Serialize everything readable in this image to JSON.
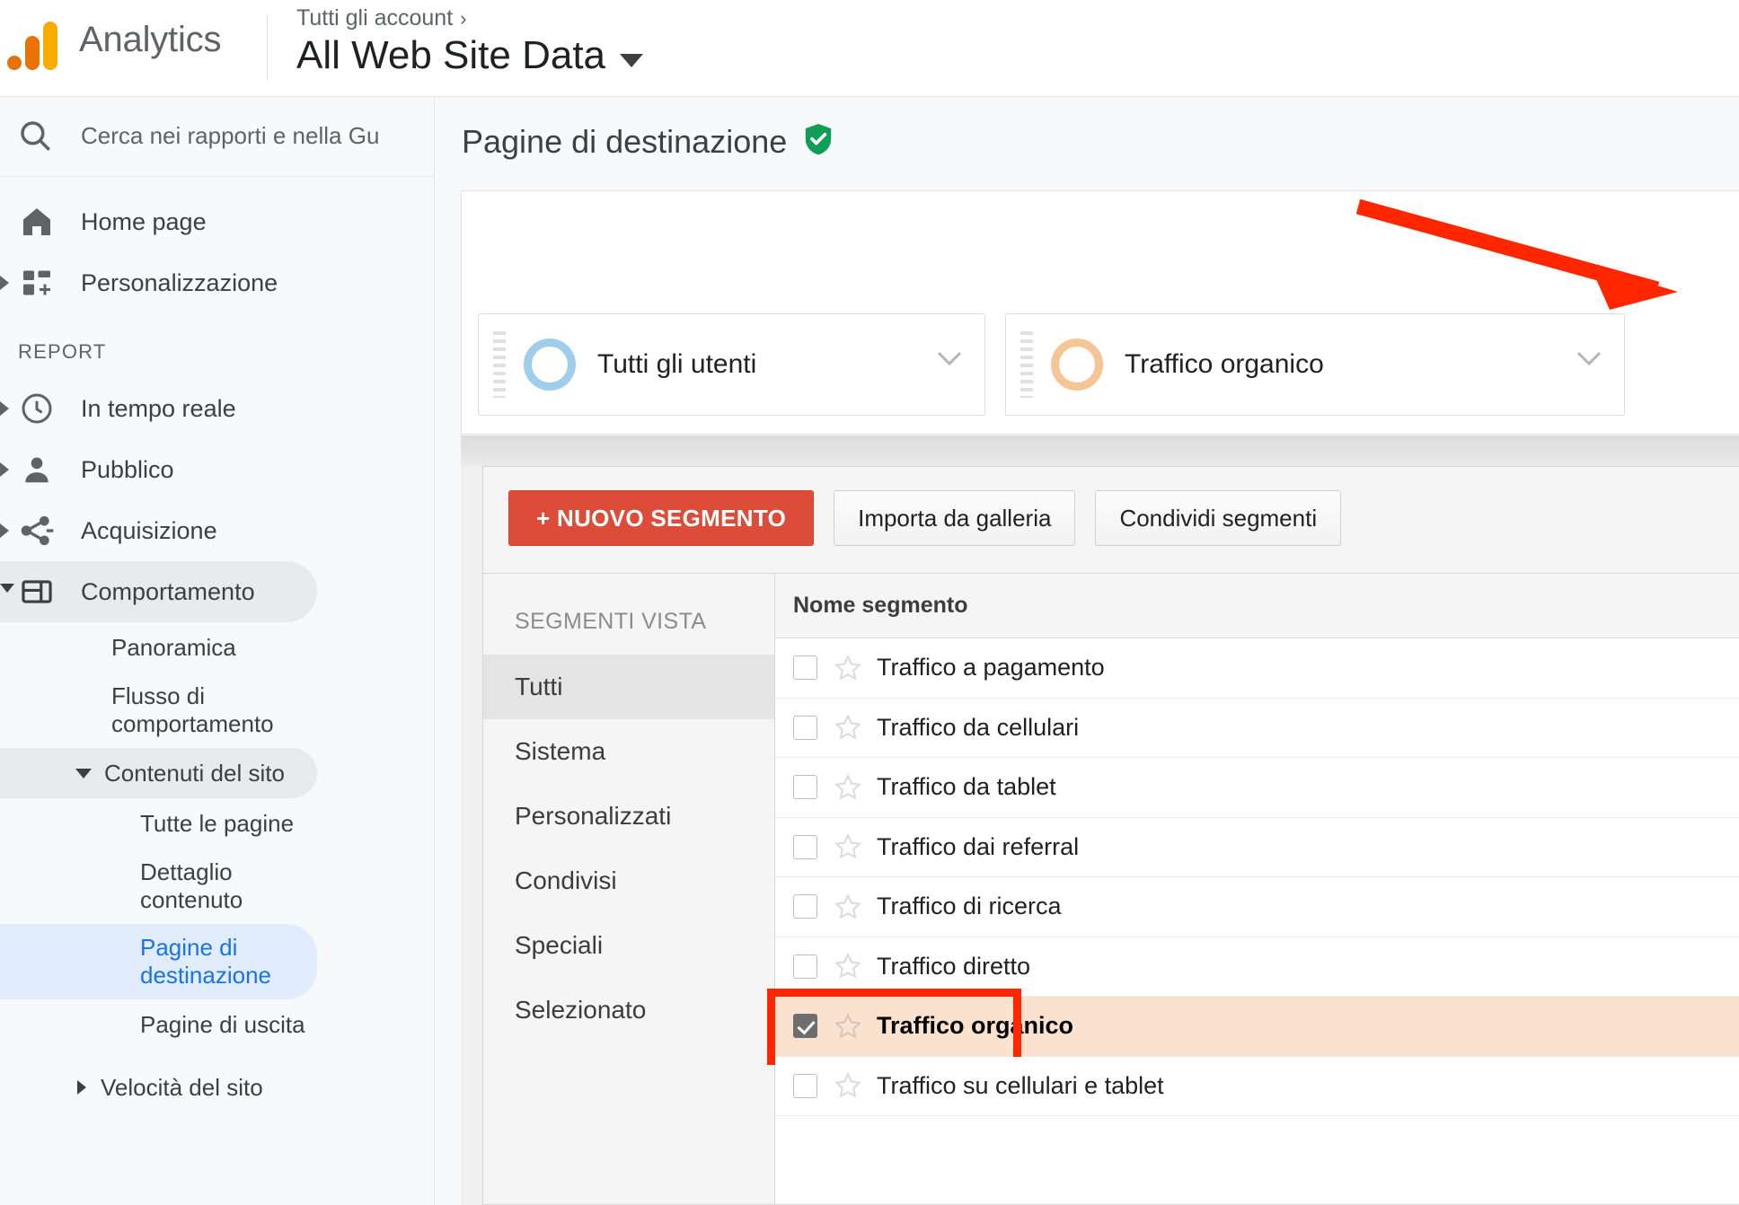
{
  "header": {
    "brand": "Analytics",
    "logo_icon": "analytics-logo",
    "breadcrumb": "Tutti gli account",
    "breadcrumb_chevron": "›",
    "property_title": "All Web Site Data",
    "property_caret_icon": "caret-down-icon"
  },
  "sidebar": {
    "search": {
      "icon": "search-icon",
      "placeholder": "Cerca nei rapporti e nella Gu"
    },
    "top_items": [
      {
        "label": "Home page",
        "icon": "home-icon",
        "expandable": false
      },
      {
        "label": "Personalizzazione",
        "icon": "customization-icon",
        "expandable": true
      }
    ],
    "section_label": "REPORT",
    "report_items": [
      {
        "label": "In tempo reale",
        "icon": "clock-icon",
        "expandable": true
      },
      {
        "label": "Pubblico",
        "icon": "person-icon",
        "expandable": true
      },
      {
        "label": "Acquisizione",
        "icon": "acquisition-icon",
        "expandable": true
      },
      {
        "label": "Comportamento",
        "icon": "behavior-icon",
        "expandable": true,
        "selected": true
      }
    ],
    "behavior_children": [
      {
        "label": "Panoramica",
        "type": "leaf"
      },
      {
        "label": "Flusso di comportamento",
        "type": "leaf"
      },
      {
        "label": "Contenuti del sito",
        "type": "group-expanded"
      },
      {
        "label": "Tutte le pagine",
        "type": "subleaf"
      },
      {
        "label": "Dettaglio contenuto",
        "type": "subleaf"
      },
      {
        "label": "Pagine di destinazione",
        "type": "subleaf",
        "active": true
      },
      {
        "label": "Pagine di uscita",
        "type": "subleaf"
      },
      {
        "label": "Velocità del sito",
        "type": "group-collapsed"
      }
    ]
  },
  "main": {
    "page_title": "Pagine di destinazione",
    "page_title_badge_icon": "green-shield-check-icon",
    "segments": [
      {
        "label": "Tutti gli utenti",
        "ring_color": "#9fcdea",
        "chevron_icon": "chevron-down-icon",
        "grip_icon": "drag-grip-icon"
      },
      {
        "label": "Traffico organico",
        "ring_color": "#f5c596",
        "chevron_icon": "chevron-down-icon",
        "grip_icon": "drag-grip-icon"
      }
    ]
  },
  "segment_manager": {
    "buttons": [
      {
        "label": "+ NUOVO SEGMENTO",
        "style": "primary"
      },
      {
        "label": "Importa da galleria",
        "style": "default"
      },
      {
        "label": "Condividi segmenti",
        "style": "default"
      }
    ],
    "categories_header": "SEGMENTI VISTA",
    "categories": [
      {
        "label": "Tutti",
        "selected": true
      },
      {
        "label": "Sistema",
        "selected": false
      },
      {
        "label": "Personalizzati",
        "selected": false
      },
      {
        "label": "Condivisi",
        "selected": false
      },
      {
        "label": "Speciali",
        "selected": false
      },
      {
        "label": "Selezionato",
        "selected": false
      }
    ],
    "table_header": "Nome segmento",
    "rows": [
      {
        "label": "Traffico a pagamento",
        "checked": false,
        "starred": false,
        "highlighted": false
      },
      {
        "label": "Traffico da cellulari",
        "checked": false,
        "starred": false,
        "highlighted": false
      },
      {
        "label": "Traffico da tablet",
        "checked": false,
        "starred": false,
        "highlighted": false
      },
      {
        "label": "Traffico dai referral",
        "checked": false,
        "starred": false,
        "highlighted": false
      },
      {
        "label": "Traffico di ricerca",
        "checked": false,
        "starred": false,
        "highlighted": false
      },
      {
        "label": "Traffico diretto",
        "checked": false,
        "starred": false,
        "highlighted": false
      },
      {
        "label": "Traffico organico",
        "checked": true,
        "starred": false,
        "highlighted": true
      },
      {
        "label": "Traffico su cellulari e tablet",
        "checked": false,
        "starred": false,
        "highlighted": false
      }
    ]
  },
  "annotations": {
    "arrow_color": "#ff2600",
    "highlight_box_color": "#ff2600",
    "arrow_icon": "red-arrow-annotation",
    "box_icon": "red-rectangle-annotation"
  },
  "colors": {
    "primary_button": "#dd4b39",
    "active_nav": "#1a73e8",
    "logo_orange_dark": "#e8710a",
    "logo_orange_light": "#f9ab00",
    "shield_green": "#0f9d58"
  }
}
